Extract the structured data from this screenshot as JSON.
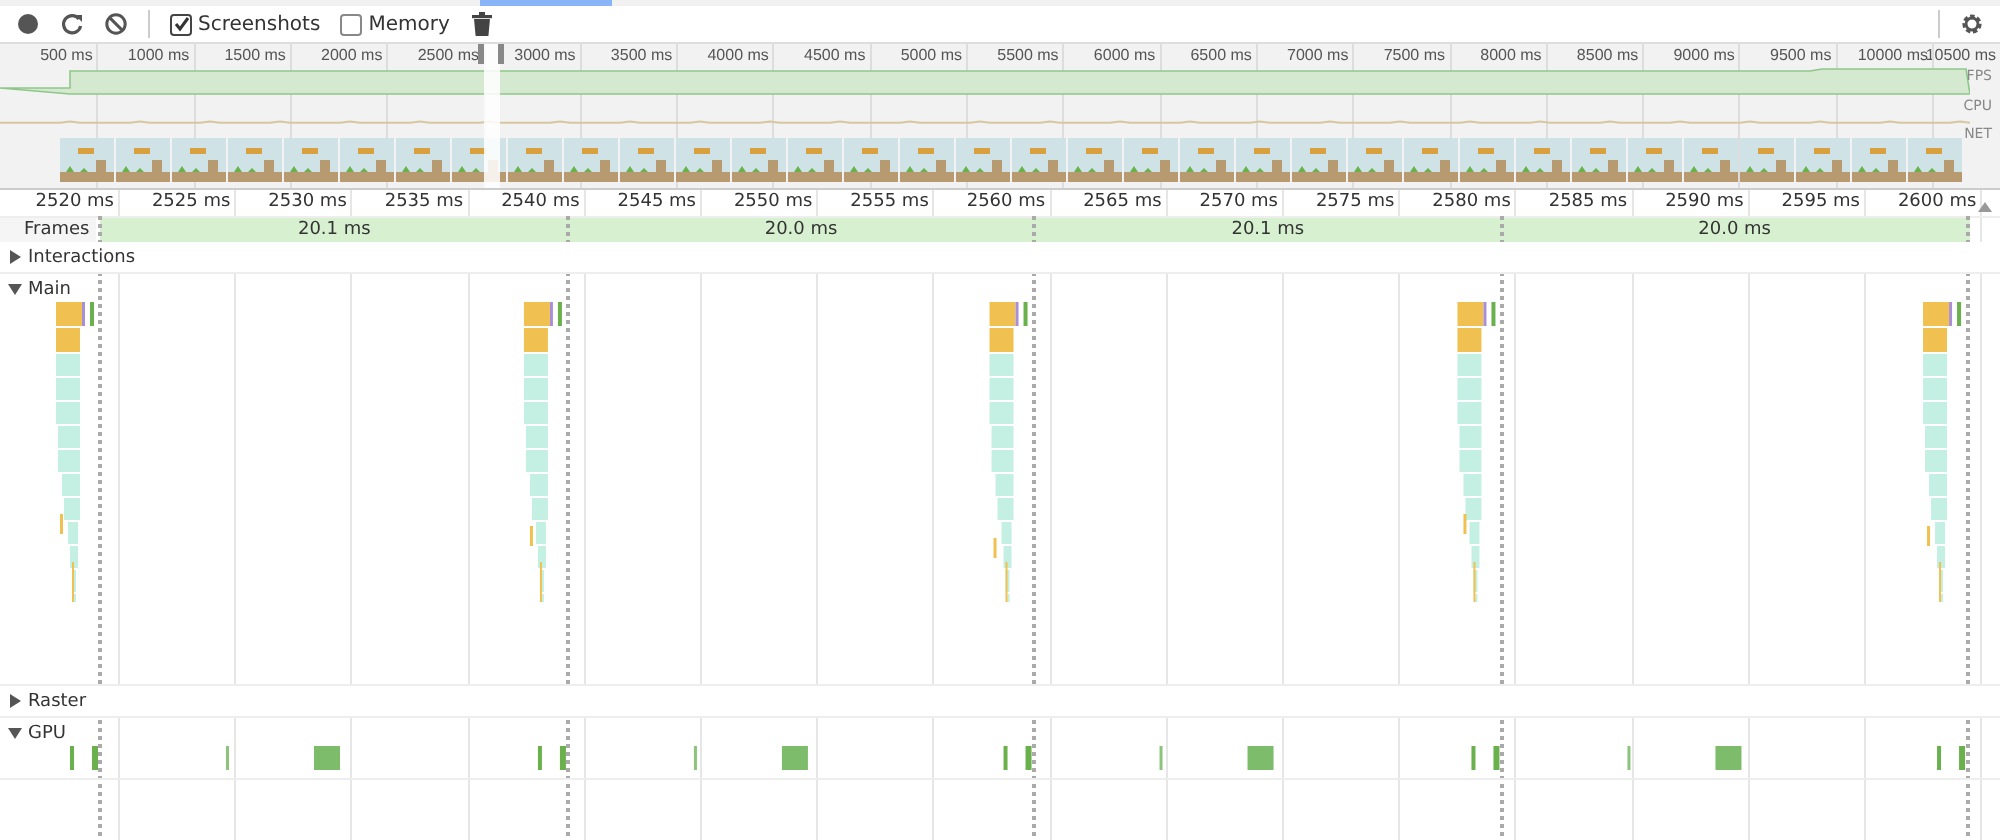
{
  "toolbar": {
    "checkboxes": [
      {
        "label": "Screenshots",
        "checked": true
      },
      {
        "label": "Memory",
        "checked": false
      }
    ]
  },
  "overview": {
    "ticks": [
      "500 ms",
      "1000 ms",
      "1500 ms",
      "2000 ms",
      "2500 ms",
      "3000 ms",
      "3500 ms",
      "4000 ms",
      "4500 ms",
      "5000 ms",
      "5500 ms",
      "6000 ms",
      "6500 ms",
      "7000 ms",
      "7500 ms",
      "8000 ms",
      "8500 ms",
      "9000 ms",
      "9500 ms",
      "10000 ms",
      "10500 ms"
    ],
    "tracks": [
      "FPS",
      "CPU",
      "NET"
    ]
  },
  "timeline": {
    "ticks": [
      "2520 ms",
      "2525 ms",
      "2530 ms",
      "2535 ms",
      "2540 ms",
      "2545 ms",
      "2550 ms",
      "2555 ms",
      "2560 ms",
      "2565 ms",
      "2570 ms",
      "2575 ms",
      "2580 ms",
      "2585 ms",
      "2590 ms",
      "2595 ms",
      "2600 ms"
    ],
    "frames": {
      "label": "Frames",
      "durations": [
        "20.1 ms",
        "20.0 ms",
        "20.1 ms",
        "20.0 ms"
      ]
    },
    "tracks": [
      {
        "label": "Interactions",
        "kind": "plain",
        "expanded": false
      },
      {
        "label": "Main",
        "kind": "flame",
        "expanded": true
      },
      {
        "label": "Raster",
        "kind": "plain",
        "expanded": false
      },
      {
        "label": "GPU",
        "kind": "gpu",
        "expanded": true
      }
    ]
  }
}
